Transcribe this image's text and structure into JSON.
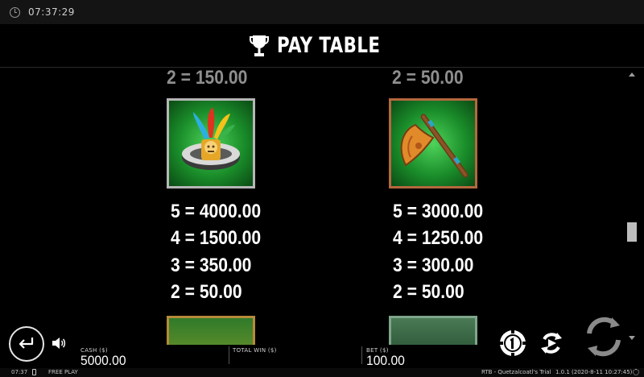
{
  "status_bar": {
    "time": "07:37:29"
  },
  "header": {
    "title": "PAY TABLE",
    "icon": "trophy-icon"
  },
  "paytable": {
    "top_partial": [
      "2 = 150.00",
      "2 = 50.00"
    ],
    "symbols": [
      {
        "name": "feathered-headband",
        "icon": "feathered-headband-icon",
        "border_color": "#b6b6b6",
        "payouts": [
          "5 = 4000.00",
          "4 = 1500.00",
          "3 = 350.00",
          "2 = 50.00"
        ]
      },
      {
        "name": "golden-axe",
        "icon": "axe-icon",
        "border_color": "#b4683e",
        "payouts": [
          "5 = 3000.00",
          "4 = 1250.00",
          "3 = 300.00",
          "2 = 50.00"
        ]
      }
    ]
  },
  "footer": {
    "cash_label": "CASH ($)",
    "cash_value": "5000.00",
    "total_win_label": "TOTAL WIN ($)",
    "total_win_value": "",
    "bet_label": "BET ($)",
    "bet_value": "100.00",
    "icons": [
      "back-arrow-icon",
      "speaker-icon",
      "coin-value-icon",
      "autoplay-icon",
      "spin-icon"
    ]
  },
  "status_strip": {
    "clock": "07:37",
    "mode": "FREE PLAY",
    "game": "RTB - Quetzalcoatl's Trial",
    "version": "1.0.1 (2020-8-11 10:27:45)"
  }
}
